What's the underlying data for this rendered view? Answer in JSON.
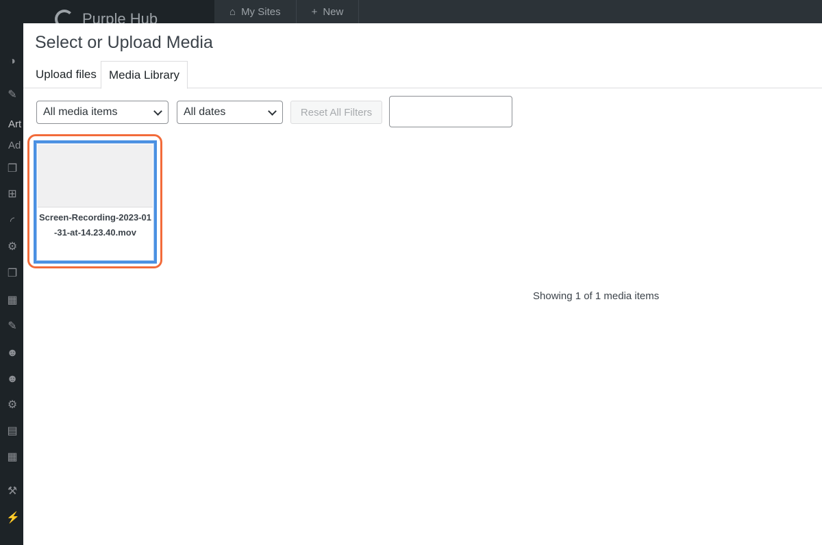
{
  "adminbar": {
    "site_name": "Purple Hub",
    "my_sites": "My Sites",
    "new_label": "New"
  },
  "sidebar": {
    "text_items": [
      "Art",
      "Ad"
    ],
    "icons": [
      "dashboard-icon",
      "pin-icon",
      "pages-icon",
      "layout-icon",
      "rss-icon",
      "users-group-icon",
      "copy-icon",
      "calendar-icon",
      "pin-icon",
      "people-icon",
      "people-icon",
      "gear-icon",
      "newspaper-icon",
      "grid-icon",
      "hammer-icon",
      "plug-icon"
    ]
  },
  "modal": {
    "title": "Select or Upload Media",
    "tabs": [
      {
        "label": "Upload files",
        "active": false
      },
      {
        "label": "Media Library",
        "active": true
      }
    ],
    "filters": {
      "media_type": "All media items",
      "dates": "All dates",
      "reset_label": "Reset All Filters",
      "search_value": ""
    },
    "attachments": [
      {
        "filename": "Screen-Recording-2023-01-31-at-14.23.40.mov",
        "selected": true
      }
    ],
    "count_text": "Showing 1 of 1 media items"
  },
  "colors": {
    "highlight": "#f26b3a",
    "selection": "#4a90e2"
  }
}
